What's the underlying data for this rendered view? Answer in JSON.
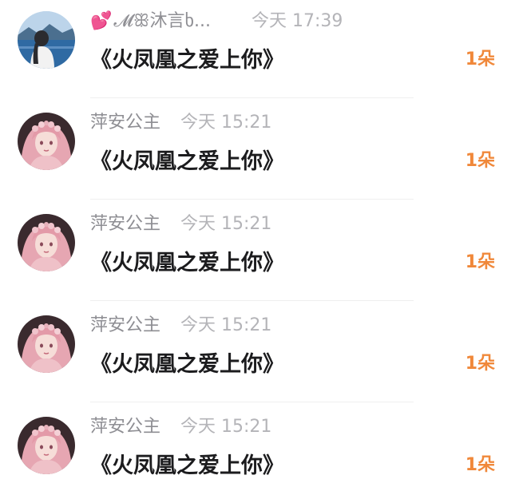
{
  "messages": [
    {
      "user": "𝓜ꕥ沐言ხ...",
      "time": "今天 17:39",
      "content": "《火凤凰之爱上你》",
      "count": "1朵",
      "avatar": "lake-portrait-avatar",
      "has_heart": true
    },
    {
      "user": "萍安公主",
      "time": "今天 15:21",
      "content": "《火凤凰之爱上你》",
      "count": "1朵",
      "avatar": "pink-hair-girl-avatar"
    },
    {
      "user": "萍安公主",
      "time": "今天 15:21",
      "content": "《火凤凰之爱上你》",
      "count": "1朵",
      "avatar": "pink-hair-girl-avatar"
    },
    {
      "user": "萍安公主",
      "time": "今天 15:21",
      "content": "《火凤凰之爱上你》",
      "count": "1朵",
      "avatar": "pink-hair-girl-avatar"
    },
    {
      "user": "萍安公主",
      "time": "今天 15:21",
      "content": "《火凤凰之爱上你》",
      "count": "1朵",
      "avatar": "pink-hair-girl-avatar"
    }
  ],
  "colors": {
    "accent": "#f0883a",
    "name": "#8e8e93",
    "time": "#b4b4b8",
    "text": "#1c1c1e"
  }
}
